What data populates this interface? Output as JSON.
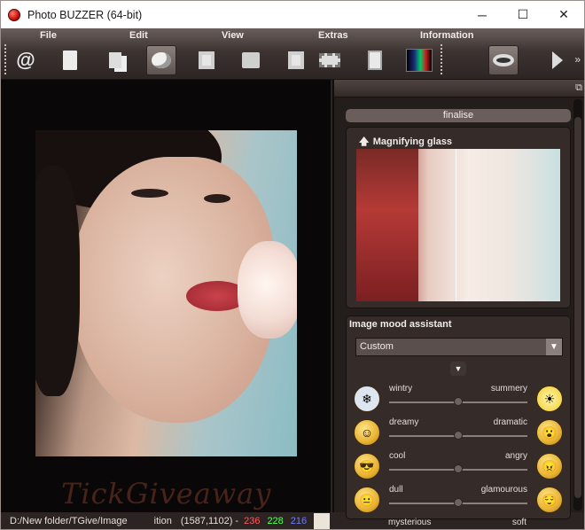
{
  "window": {
    "title": "Photo BUZZER (64-bit)",
    "min": "─",
    "max": "☐",
    "close": "✕"
  },
  "menu": {
    "file": "File",
    "edit": "Edit",
    "view": "View",
    "extras": "Extras",
    "information": "Information"
  },
  "status": {
    "path": "D:/New folder/TGive/Image",
    "position_label": "ition",
    "coords": "(1587,1102) -",
    "r": "236",
    "g": "228",
    "b": "216"
  },
  "watermark": "TickGiveaway",
  "panel": {
    "finalise": "finalise",
    "magnifier_title": "Magnifying glass",
    "mood_title": "Image mood assistant",
    "mood_preset": "Custom",
    "moods": [
      {
        "left": "wintry",
        "right": "summery",
        "value": 0.5
      },
      {
        "left": "dreamy",
        "right": "dramatic",
        "value": 0.5
      },
      {
        "left": "cool",
        "right": "angry",
        "value": 0.5
      },
      {
        "left": "dull",
        "right": "glamourous",
        "value": 0.5
      },
      {
        "left": "mysterious",
        "right": "soft",
        "value": 0.5
      }
    ]
  }
}
